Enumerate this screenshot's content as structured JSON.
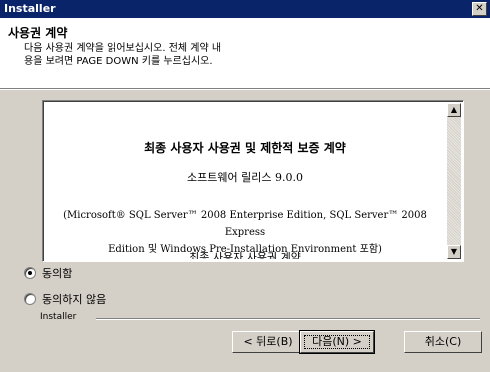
{
  "window": {
    "title": "Installer",
    "close_glyph": "✕"
  },
  "header": {
    "heading": "사용권 계약",
    "subtitle_line1": "다음 사용권 계약을 읽어보십시오. 전체 계약 내",
    "subtitle_line2": "용을 보려면 PAGE DOWN 키를 누르십시오."
  },
  "license": {
    "title": "최종 사용자 사용권 및 제한적 보증 계약",
    "release": "소프트웨어 릴리스 9.0.0",
    "edition_line1": "(Microsoft® SQL Server™ 2008 Enterprise Edition, SQL Server™ 2008 Express",
    "edition_line2": "Edition 및 Windows Pre-Installation Environment 포함)",
    "partial_line": "최종 사용자 사용권 계약"
  },
  "options": {
    "agree": {
      "label": "동의함",
      "checked": true
    },
    "disagree": {
      "label": "동의하지 않음",
      "checked": false
    }
  },
  "footer": {
    "group_label": "Installer",
    "back_label": "< 뒤로(B)",
    "next_label": "다음(N) >",
    "cancel_label": "취소(C)"
  },
  "scrollbar": {
    "up_glyph": "▲",
    "down_glyph": "▼"
  },
  "colors": {
    "titlebar": "#0a246a",
    "dialog_bg": "#d4d0c8"
  }
}
